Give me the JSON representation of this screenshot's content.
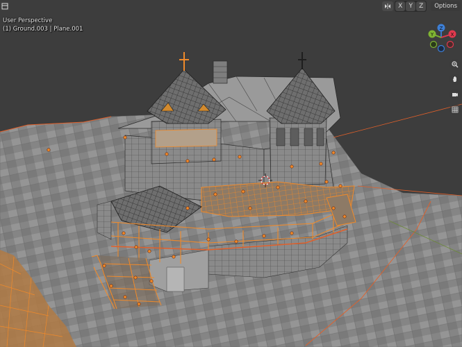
{
  "viewport": {
    "view_name": "User Perspective",
    "object_info": "(1) Ground.003 | Plane.001"
  },
  "header": {
    "mirror_icon": "mirror-icon",
    "axis_x": "X",
    "axis_y": "Y",
    "axis_z": "Z",
    "options_label": "Options",
    "mode_icon": "editor-type-icon"
  },
  "gizmo": {
    "x_label": "X",
    "y_label": "Y",
    "z_label": "Z",
    "x_color": "#e2394e",
    "y_color": "#7fb432",
    "z_color": "#3d7fd6"
  },
  "nav_buttons": [
    "zoom-icon",
    "pan-hand-icon",
    "camera-icon",
    "grid-ortho-icon"
  ],
  "colors": {
    "background": "#3d3d3d",
    "mesh_gray": "#8c8c8c",
    "selected_orange": "#f08a2a",
    "wire_dark": "#2a2a2a"
  }
}
